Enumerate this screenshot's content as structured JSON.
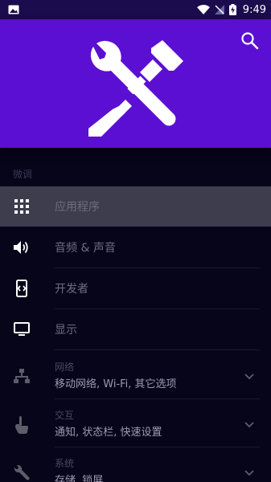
{
  "status_bar": {
    "time": "9:49",
    "icons": [
      "image-notification-icon",
      "wifi-icon",
      "no-signal-icon",
      "battery-charging-icon"
    ]
  },
  "header": {
    "hero_icon": "tools-wrench-screwdriver-icon",
    "search_icon": "search-icon"
  },
  "section": {
    "label": "微调"
  },
  "menu": [
    {
      "label": "应用程序",
      "icon": "apps-grid-icon",
      "selected": true
    },
    {
      "label": "音频 & 声音",
      "icon": "volume-icon"
    },
    {
      "label": "开发者",
      "icon": "developer-phone-icon"
    },
    {
      "label": "显示",
      "icon": "monitor-icon"
    }
  ],
  "expandable": [
    {
      "title": "网络",
      "subtitle": "移动网络, Wi-Fi, 其它选项",
      "icon": "network-icon"
    },
    {
      "title": "交互",
      "subtitle": "通知, 状态栏, 快速设置",
      "icon": "touch-icon"
    },
    {
      "title": "系统",
      "subtitle": "存储, 锁屏",
      "icon": "wrench-icon"
    }
  ],
  "colors": {
    "header": "#5b0fd3",
    "status_bar": "#1a0c4d",
    "background": "#06051a",
    "selected_row": "#3e3d4e"
  }
}
